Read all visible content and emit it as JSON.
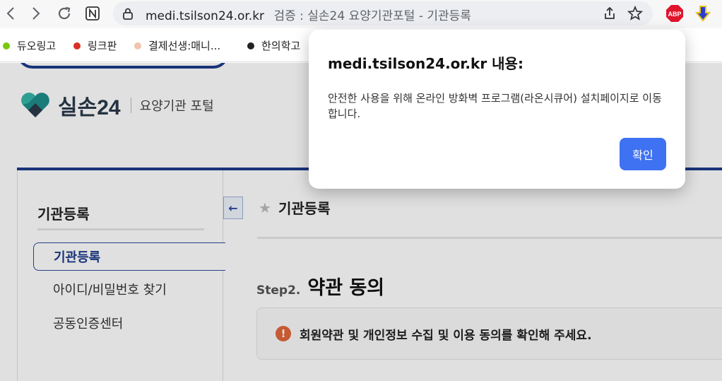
{
  "browser": {
    "url_host": "medi.tsilson24.or.kr",
    "url_page_title": "검증 : 실손24 요양기관포털 - 기관등록",
    "bookmarks": [
      {
        "label": "듀오링고",
        "color": "#7ac70c"
      },
      {
        "label": "링크판",
        "color": "#d93025"
      },
      {
        "label": "결제선생:매니...",
        "color": "#f2c4ad"
      },
      {
        "label": "한의학고",
        "color": "#222222"
      }
    ],
    "extensions": [
      "abp-icon",
      "arrow-down-extension-icon"
    ],
    "abp_label": "ABP"
  },
  "page": {
    "logo_text": "실손24",
    "logo_sub": "요양기관 포털",
    "sidebar": {
      "title": "기관등록",
      "items": [
        {
          "label": "기관등록",
          "active": true
        },
        {
          "label": "아이디/비밀번호 찾기",
          "active": false
        },
        {
          "label": "공동인증센터",
          "active": false
        }
      ]
    },
    "content": {
      "title": "기관등록",
      "step_label": "Step2.",
      "step_title": "약관 동의",
      "notice_icon": "!",
      "notice_text": "회원약관 및 개인정보 수집 및 이용 동의를 확인해 주세요."
    },
    "brand_color": "#1c3b8a"
  },
  "dialog": {
    "title": "medi.tsilson24.or.kr 내용:",
    "message": "안전한 사용을 위해 온라인 방화벽 프로그램(라온시큐어) 설치페이지로 이동합니다.",
    "confirm_label": "확인",
    "confirm_color": "#3f72f2"
  }
}
